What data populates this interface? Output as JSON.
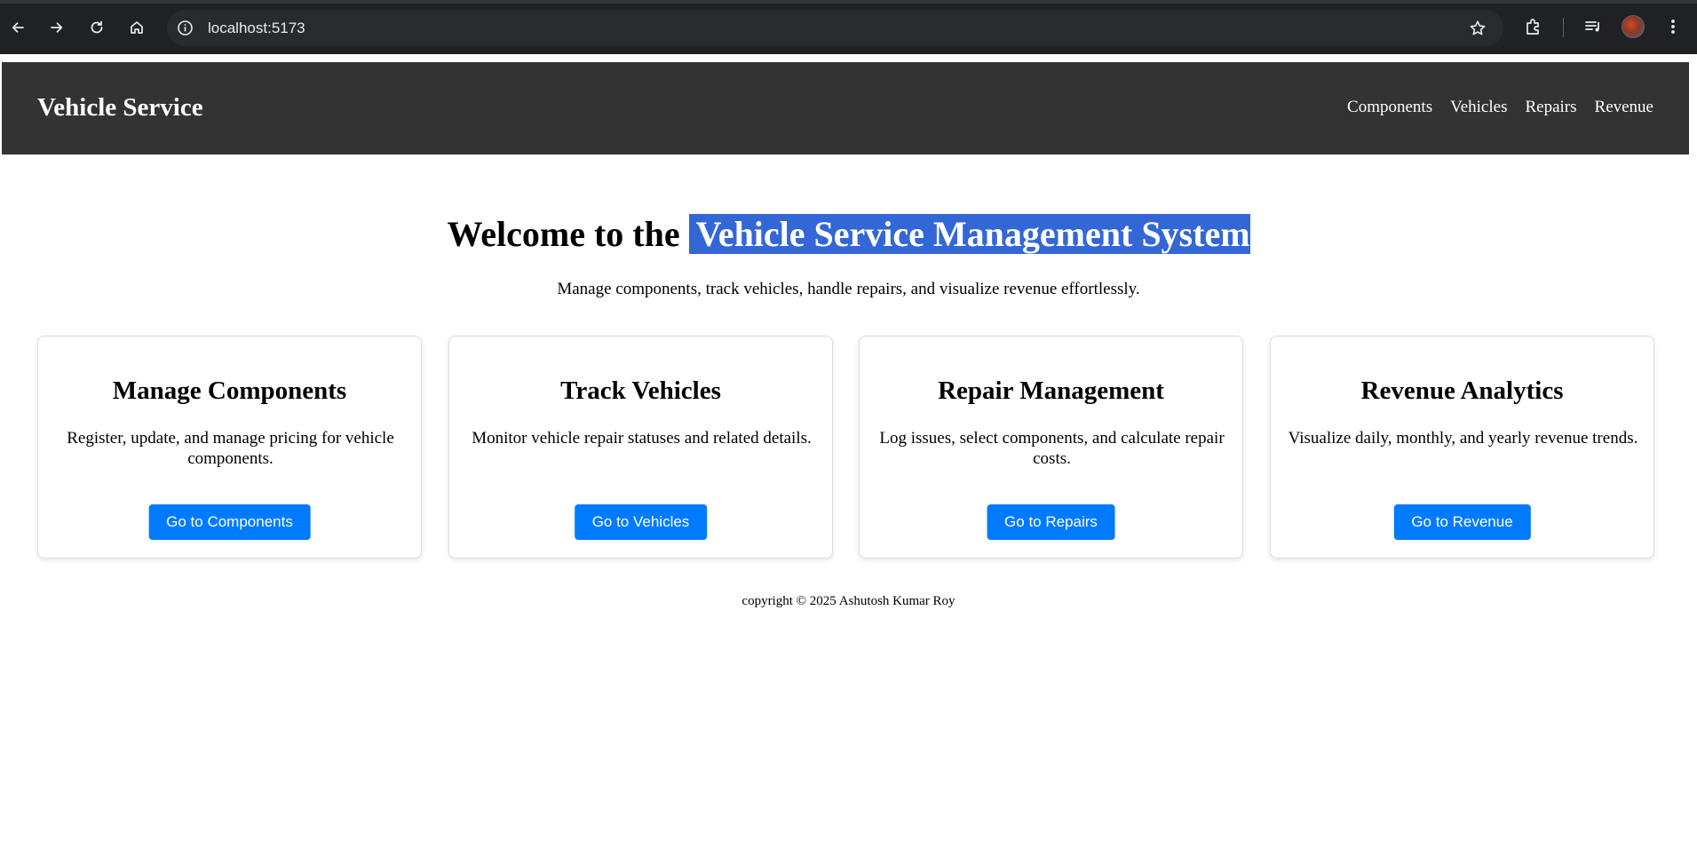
{
  "browser": {
    "url": "localhost:5173",
    "icons": [
      "back-icon",
      "forward-icon",
      "reload-icon",
      "home-icon",
      "info-icon",
      "star-icon",
      "extensions-icon",
      "media-controls-icon",
      "avatar",
      "more-icon"
    ]
  },
  "navbar": {
    "brand": "Vehicle Service",
    "links": [
      "Components",
      "Vehicles",
      "Repairs",
      "Revenue"
    ]
  },
  "hero": {
    "title_plain": "Welcome to the",
    "title_highlight": "Vehicle Service Management System",
    "subtitle": "Manage components, track vehicles, handle repairs, and visualize revenue effortlessly."
  },
  "cards": [
    {
      "title": "Manage Components",
      "description": "Register, update, and manage pricing for vehicle components.",
      "button": "Go to Components"
    },
    {
      "title": "Track Vehicles",
      "description": "Monitor vehicle repair statuses and related details.",
      "button": "Go to Vehicles"
    },
    {
      "title": "Repair Management",
      "description": "Log issues, select components, and calculate repair costs.",
      "button": "Go to Repairs"
    },
    {
      "title": "Revenue Analytics",
      "description": "Visualize daily, monthly, and yearly revenue trends.",
      "button": "Go to Revenue"
    }
  ],
  "footer": {
    "text": "copyright © 2025 Ashutosh Kumar Roy"
  },
  "colors": {
    "navbar_bg": "#333333",
    "button_bg": "#007bff",
    "selection_bg": "#3367d6"
  }
}
